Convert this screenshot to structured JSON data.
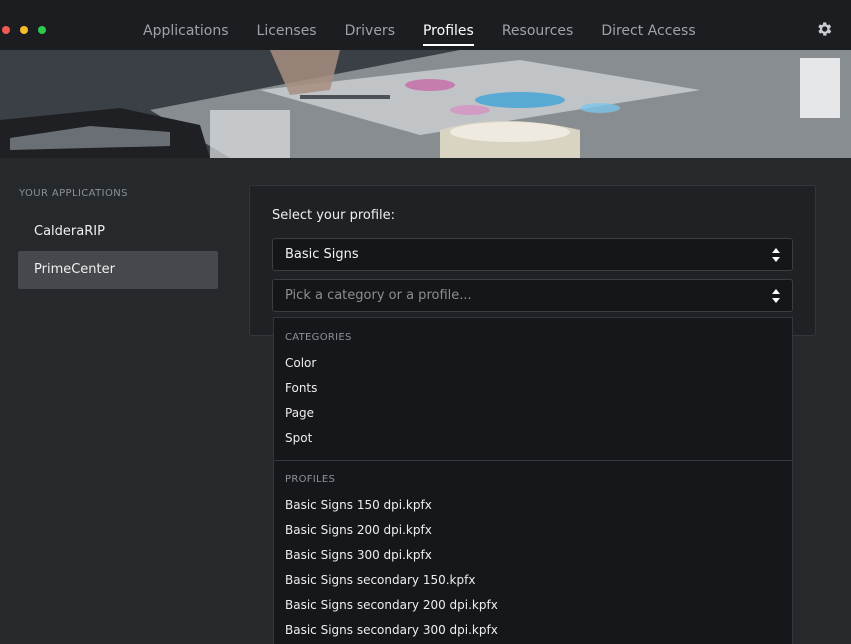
{
  "nav": {
    "tabs": [
      {
        "label": "Applications"
      },
      {
        "label": "Licenses"
      },
      {
        "label": "Drivers"
      },
      {
        "label": "Profiles"
      },
      {
        "label": "Resources"
      },
      {
        "label": "Direct Access"
      }
    ],
    "active_tab": "Profiles"
  },
  "sidebar": {
    "heading": "YOUR APPLICATIONS",
    "items": [
      {
        "label": "CalderaRIP"
      },
      {
        "label": "PrimeCenter"
      }
    ],
    "selected": "PrimeCenter"
  },
  "panel": {
    "label": "Select your profile:",
    "profile_select_value": "Basic Signs",
    "category_placeholder": "Pick a category or a profile..."
  },
  "dropdown": {
    "categories_heading": "CATEGORIES",
    "categories": [
      "Color",
      "Fonts",
      "Page",
      "Spot"
    ],
    "profiles_heading": "PROFILES",
    "profiles": [
      "Basic Signs 150 dpi.kpfx",
      "Basic Signs 200 dpi.kpfx",
      "Basic Signs 300 dpi.kpfx",
      "Basic Signs secondary 150.kpfx",
      "Basic Signs secondary 200 dpi.kpfx",
      "Basic Signs secondary 300 dpi.kpfx"
    ]
  },
  "colors": {
    "topbar": "#1b1d20",
    "background": "#26292c",
    "accent_active": "#ffffff"
  }
}
